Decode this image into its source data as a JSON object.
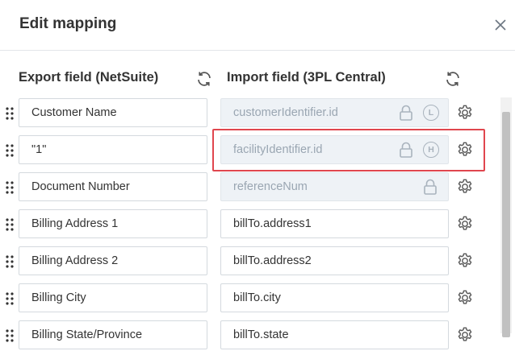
{
  "dialog": {
    "title": "Edit mapping"
  },
  "columns": {
    "export_header": "Export field (NetSuite)",
    "import_header": "Import field (3PL Central)"
  },
  "icons": {
    "close": "close-icon",
    "refresh": "refresh-icon",
    "drag": "drag-handle-icon",
    "lock": "lock-icon",
    "settings": "gear-icon"
  },
  "colors": {
    "highlight": "#e0464e",
    "locked_background": "#eef2f6"
  },
  "rows": [
    {
      "export": "Customer Name",
      "import": "customerIdentifier.id",
      "locked": true,
      "badge": "L"
    },
    {
      "export": "\"1\"",
      "import": "facilityIdentifier.id",
      "locked": true,
      "badge": "H"
    },
    {
      "export": "Document Number",
      "import": "referenceNum",
      "locked": true,
      "badge": ""
    },
    {
      "export": "Billing Address 1",
      "import": "billTo.address1",
      "locked": false,
      "badge": ""
    },
    {
      "export": "Billing Address 2",
      "import": "billTo.address2",
      "locked": false,
      "badge": ""
    },
    {
      "export": "Billing City",
      "import": "billTo.city",
      "locked": false,
      "badge": ""
    },
    {
      "export": "Billing State/Province",
      "import": "billTo.state",
      "locked": false,
      "badge": ""
    }
  ]
}
